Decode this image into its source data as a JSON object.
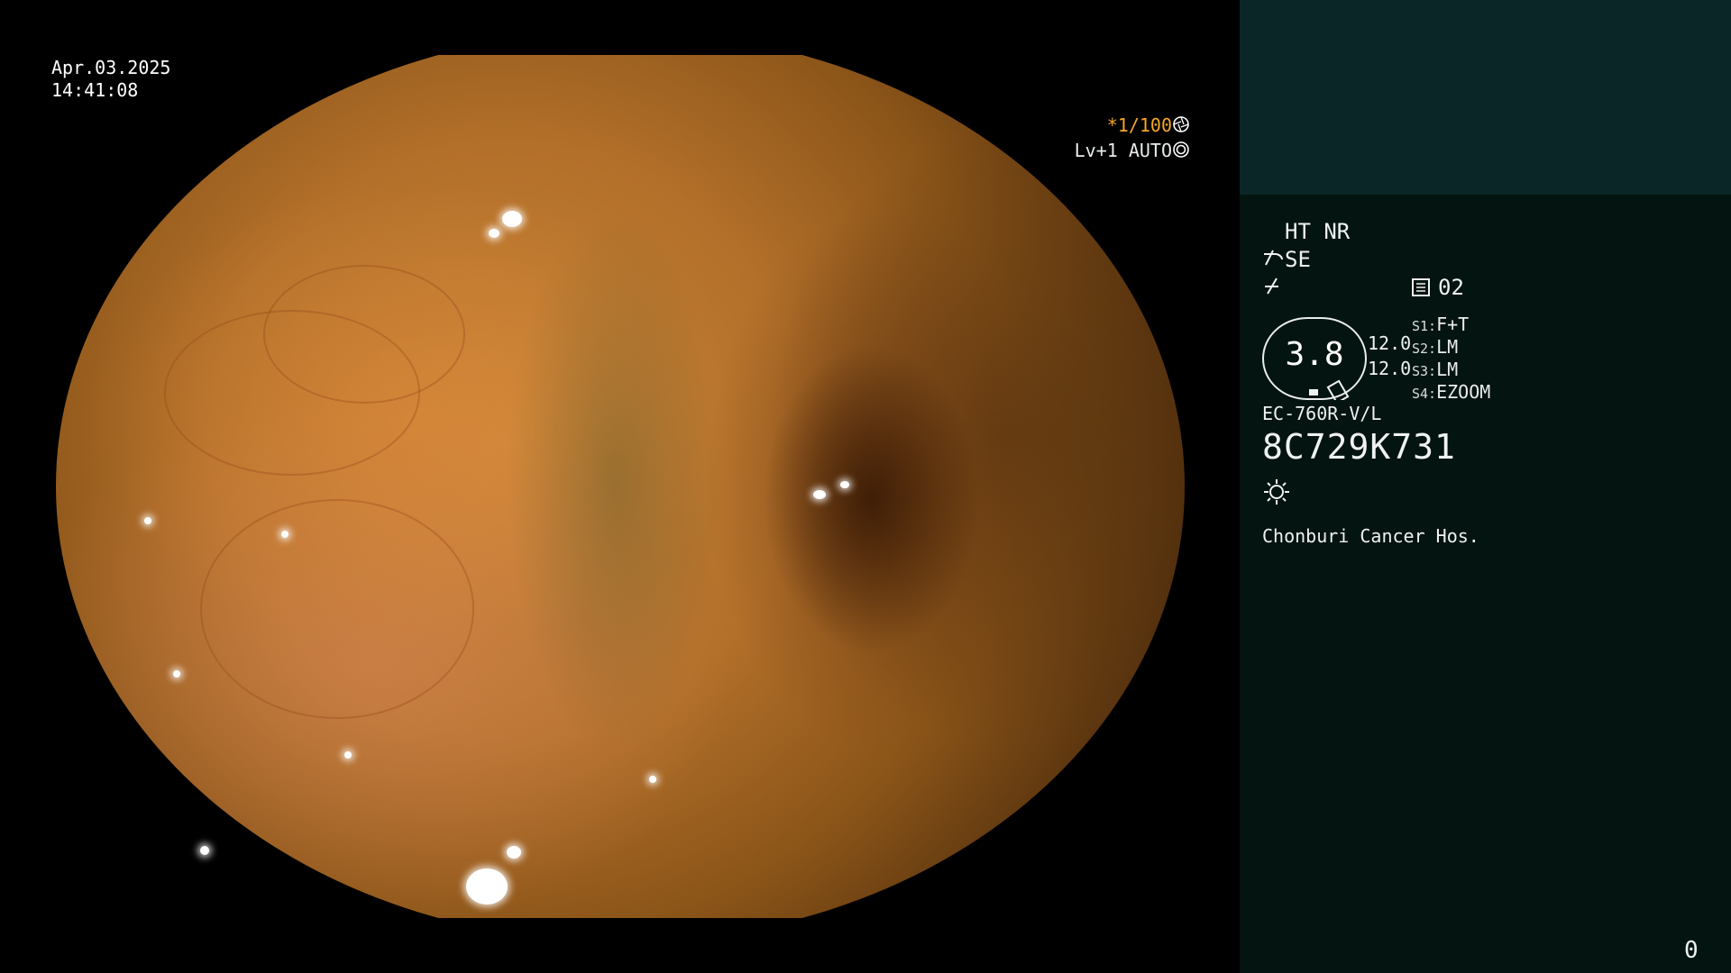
{
  "overlay": {
    "date": "Apr.03.2025",
    "time": "14:41:08",
    "shutter": "*1/100",
    "iris": "Lv+1 AUTO",
    "shutter_icon": "aperture-icon",
    "iris_icon": "iris-icon"
  },
  "panel": {
    "processing": "HT NR",
    "enhancement": "SE",
    "enhancement_icon": "structure-enhance-icon",
    "color_icon": "color-mode-icon",
    "memory_icon": "memory-card-icon",
    "memory_value": "02",
    "gauge_value": "3.8",
    "scope_values": [
      "12.0",
      "12.0"
    ],
    "switches": [
      {
        "key": "S1:",
        "value": "F+T"
      },
      {
        "key": "S2:",
        "value": "LM"
      },
      {
        "key": "S3:",
        "value": "LM"
      },
      {
        "key": "S4:",
        "value": "EZOOM"
      }
    ],
    "scope_model": "EC-760R-V/L",
    "serial": "8C729K731",
    "light_icon": "light-sun-icon",
    "institution": "Chonburi Cancer Hos.",
    "page_number": "0"
  },
  "colors": {
    "accent": "#f5a623",
    "panel_bg": "#041410",
    "panel_top_bg": "#0b2626",
    "text": "#eef2f2"
  }
}
